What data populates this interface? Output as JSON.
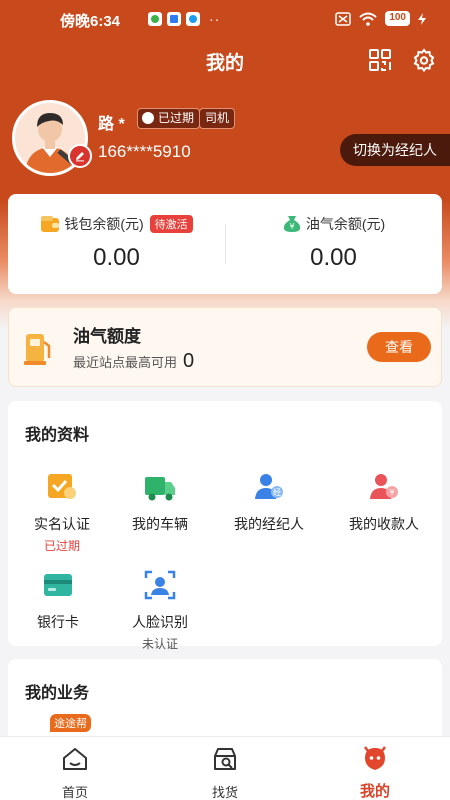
{
  "status_bar": {
    "time": "傍晚6:34",
    "more": "··",
    "battery": "100"
  },
  "header": {
    "title": "我的",
    "icons": [
      "qr-code-icon",
      "settings-gear-icon"
    ]
  },
  "profile": {
    "name": "路 *",
    "status_badge": "已过期",
    "role_badge": "司机",
    "phone": "166****5910",
    "switch_label": "切换为经纪人"
  },
  "balances": {
    "wallet": {
      "label": "钱包余额(元)",
      "tag": "待激活",
      "value": "0.00",
      "icon": "wallet-icon"
    },
    "oil": {
      "label": "油气余额(元)",
      "value": "0.00",
      "icon": "money-bag-icon"
    }
  },
  "oil_quota": {
    "title": "油气额度",
    "subtitle": "最近站点最高可用",
    "amount": "0",
    "button": "查看",
    "icon": "fuel-pump-icon"
  },
  "my_info": {
    "title": "我的资料",
    "items": [
      {
        "label": "实名认证",
        "sub": "已过期",
        "icon": "id-verify-icon",
        "sub_color": "#e8403a"
      },
      {
        "label": "我的车辆",
        "sub": "",
        "icon": "truck-icon"
      },
      {
        "label": "我的经纪人",
        "sub": "",
        "icon": "agent-icon"
      },
      {
        "label": "我的收款人",
        "sub": "",
        "icon": "payee-icon"
      },
      {
        "label": "银行卡",
        "sub": "",
        "icon": "bank-card-icon"
      },
      {
        "label": "人脸识别",
        "sub": "未认证",
        "icon": "face-scan-icon",
        "sub_color": "#555555"
      }
    ]
  },
  "my_business": {
    "title": "我的业务",
    "tag": "途途帮"
  },
  "bottom_nav": {
    "items": [
      {
        "label": "首页",
        "icon": "home-icon",
        "active": false
      },
      {
        "label": "找货",
        "icon": "find-goods-icon",
        "active": false
      },
      {
        "label": "我的",
        "icon": "my-profile-icon",
        "active": true
      }
    ]
  },
  "colors": {
    "primary": "#c84a1c",
    "accent": "#ea6a1b",
    "alert": "#e8403a",
    "active_nav": "#d8442a"
  }
}
